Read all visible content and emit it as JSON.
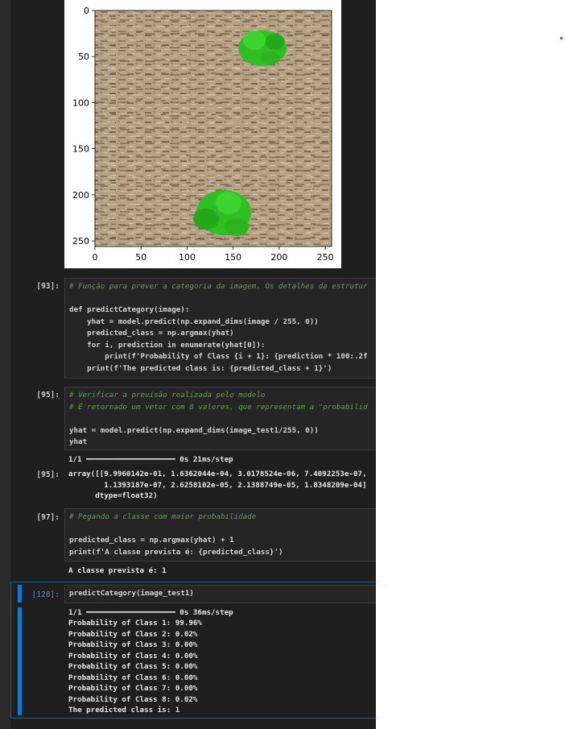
{
  "figure": {
    "x_ticks": [
      "0",
      "50",
      "100",
      "150",
      "200",
      "250"
    ],
    "y_ticks": [
      "0",
      "50",
      "100",
      "150",
      "200",
      "250"
    ]
  },
  "cells": {
    "c93": {
      "prompt": "[93]:",
      "lines": [
        "# Função para prever a categoria da imagem. Os detalhes da estrutur",
        "",
        "def predictCategory(image):",
        "    yhat = model.predict(np.expand_dims(image / 255, 0))",
        "    predicted_class = np.argmax(yhat)",
        "    for i, prediction in enumerate(yhat[0]):",
        "        print(f'Probability of Class {i + 1}: {prediction * 100:.2f",
        "    print(f'The predicted class is: {predicted_class + 1}')"
      ]
    },
    "c95": {
      "prompt": "[95]:",
      "lines": [
        "# Verificar a previsão realizada pelo modelo",
        "# É retornado um vetor com 8 valores, que representam a \"probabilid",
        "",
        "yhat = model.predict(np.expand_dims(image_test1/255, 0))",
        "yhat"
      ],
      "progress": "1/1 ━━━━━━━━━━━━━━━━━━━━ 0s 21ms/step",
      "out_prompt": "[95]:",
      "out_lines": [
        "array([[9.9960142e-01, 1.6362044e-04, 3.0178524e-06, 7.4092253e-07,",
        "        1.1393187e-07, 2.6258102e-05, 2.1388749e-05, 1.8348209e-04]",
        "      dtype=float32)"
      ]
    },
    "c97": {
      "prompt": "[97]:",
      "lines": [
        "# Pegando a classe com maior probabilidade",
        "",
        "predicted_class = np.argmax(yhat) + 1",
        "print(f'A classe prevista é: {predicted_class}')"
      ],
      "output": "A classe prevista é: 1"
    },
    "c128": {
      "prompt": "[128]:",
      "code": "predictCategory(image_test1)",
      "progress": "1/1 ━━━━━━━━━━━━━━━━━━━━ 0s 36ms/step",
      "out_lines": [
        "Probability of Class 1: 99.96%",
        "Probability of Class 2: 0.02%",
        "Probability of Class 3: 0.00%",
        "Probability of Class 4: 0.00%",
        "Probability of Class 5: 0.00%",
        "Probability of Class 6: 0.00%",
        "Probability of Class 7: 0.00%",
        "Probability of Class 8: 0.02%",
        "The predicted class is: 1"
      ]
    }
  },
  "colors": {
    "accent": "#0e7ad4",
    "notebook_bg": "#1f1f1f"
  }
}
